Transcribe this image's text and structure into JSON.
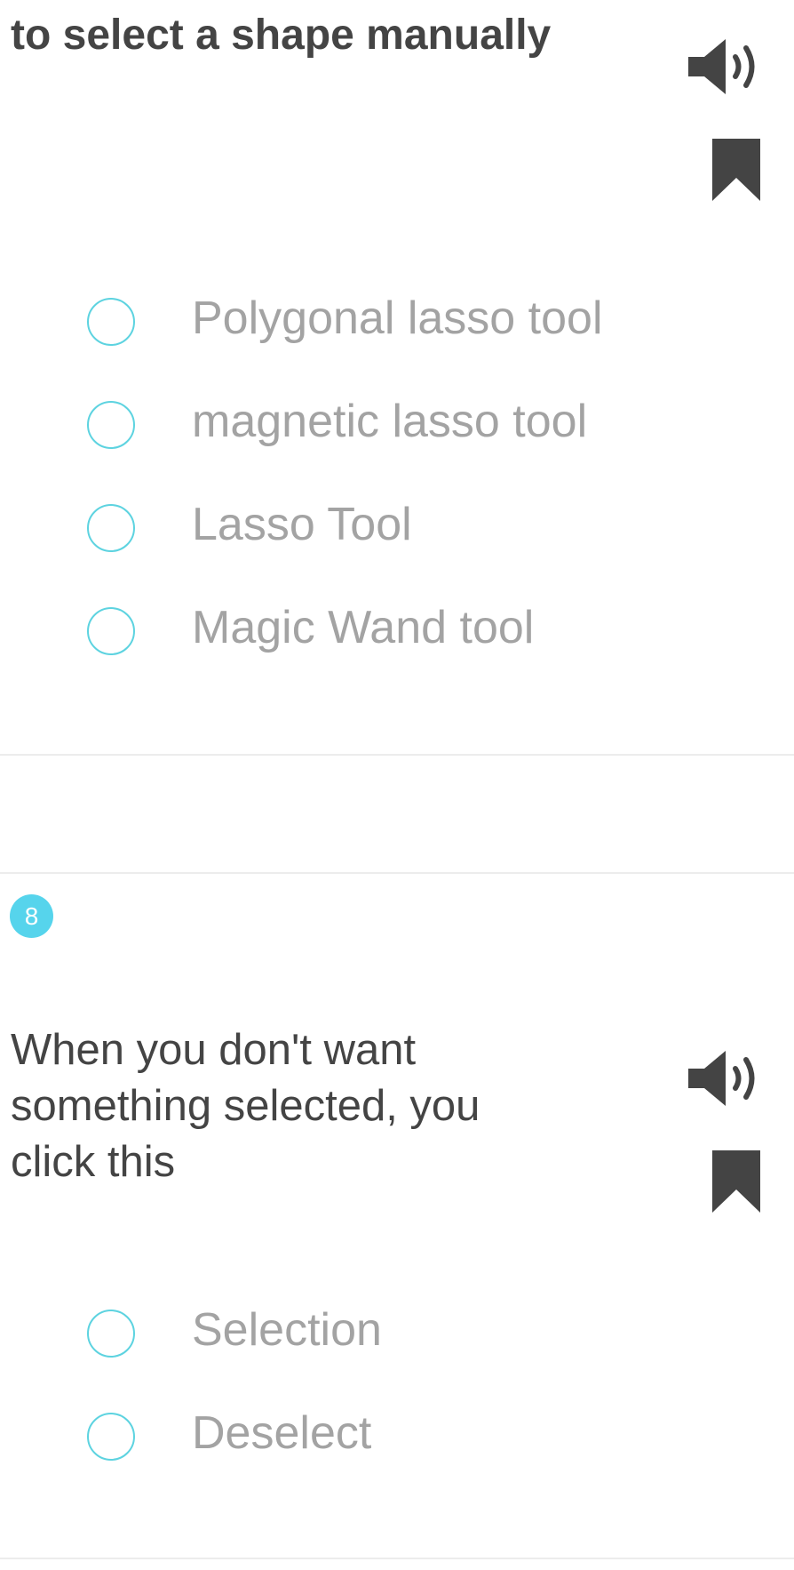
{
  "question_prev": {
    "title": "to select a shape manually",
    "options": [
      {
        "label": "Polygonal lasso tool"
      },
      {
        "label": "magnetic lasso tool"
      },
      {
        "label": "Lasso Tool"
      },
      {
        "label": "Magic Wand tool"
      }
    ],
    "audio_icon": "speaker-icon",
    "bookmark_icon": "bookmark-icon"
  },
  "question_8": {
    "number": "8",
    "title": "When you don't want something selected, you click this",
    "options": [
      {
        "label": "Selection"
      },
      {
        "label": "Deselect"
      }
    ],
    "audio_icon": "speaker-icon",
    "bookmark_icon": "bookmark-icon"
  },
  "colors": {
    "accent": "#56d4ec",
    "radio_border": "#5dd3e0",
    "title_text": "#444444",
    "option_text": "#a3a3a3",
    "divider": "#ececec"
  }
}
